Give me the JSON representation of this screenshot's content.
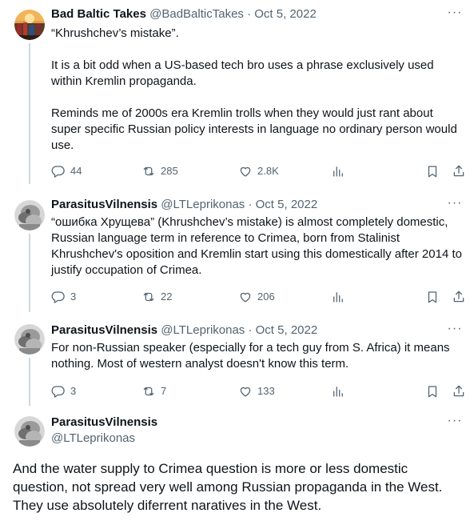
{
  "tweets": [
    {
      "name": "Bad Baltic Takes",
      "handle": "@BadBalticTakes",
      "sep": "·",
      "date": "Oct 5, 2022",
      "paragraphs": [
        "“Khrushchev’s mistake”.",
        "It is a bit odd when a US-based tech bro uses a phrase exclusively used within Kremlin propaganda.",
        "Reminds me of 2000s era Kremlin trolls when they would just rant about super specific Russian policy interests in language no ordinary person would use."
      ],
      "replies": "44",
      "retweets": "285",
      "likes": "2.8K"
    },
    {
      "name": "ParasitusVilnensis",
      "handle": "@LTLeprikonas",
      "sep": "·",
      "date": "Oct 5, 2022",
      "paragraphs": [
        "“ошибка Хрущева” (Khrushchev’s mistake) is almost completely domestic, Russian language term in reference to Crimea, born from Stalinist Khrushchev's oposition and Kremlin start using this domestically after 2014 to justify occupation of Crimea."
      ],
      "replies": "3",
      "retweets": "22",
      "likes": "206"
    },
    {
      "name": "ParasitusVilnensis",
      "handle": "@LTLeprikonas",
      "sep": "·",
      "date": "Oct 5, 2022",
      "paragraphs": [
        "For non-Russian speaker (especially for a tech guy from S. Africa) it means nothing. Most of western analyst doesn't know this term."
      ],
      "replies": "3",
      "retweets": "7",
      "likes": "133"
    }
  ],
  "focused": {
    "name": "ParasitusVilnensis",
    "handle": "@LTLeprikonas",
    "text": "And the water supply to Crimea question is more or less domestic question, not spread very well among Russian propaganda in the West. They use absolutely diferrent naratives in the West."
  },
  "colors": {
    "text": "#0f1419",
    "secondary": "#536471",
    "thread": "#cfd9de"
  },
  "icons": [
    "more-icon",
    "reply-icon",
    "retweet-icon",
    "like-icon",
    "views-icon",
    "bookmark-icon",
    "share-icon"
  ]
}
